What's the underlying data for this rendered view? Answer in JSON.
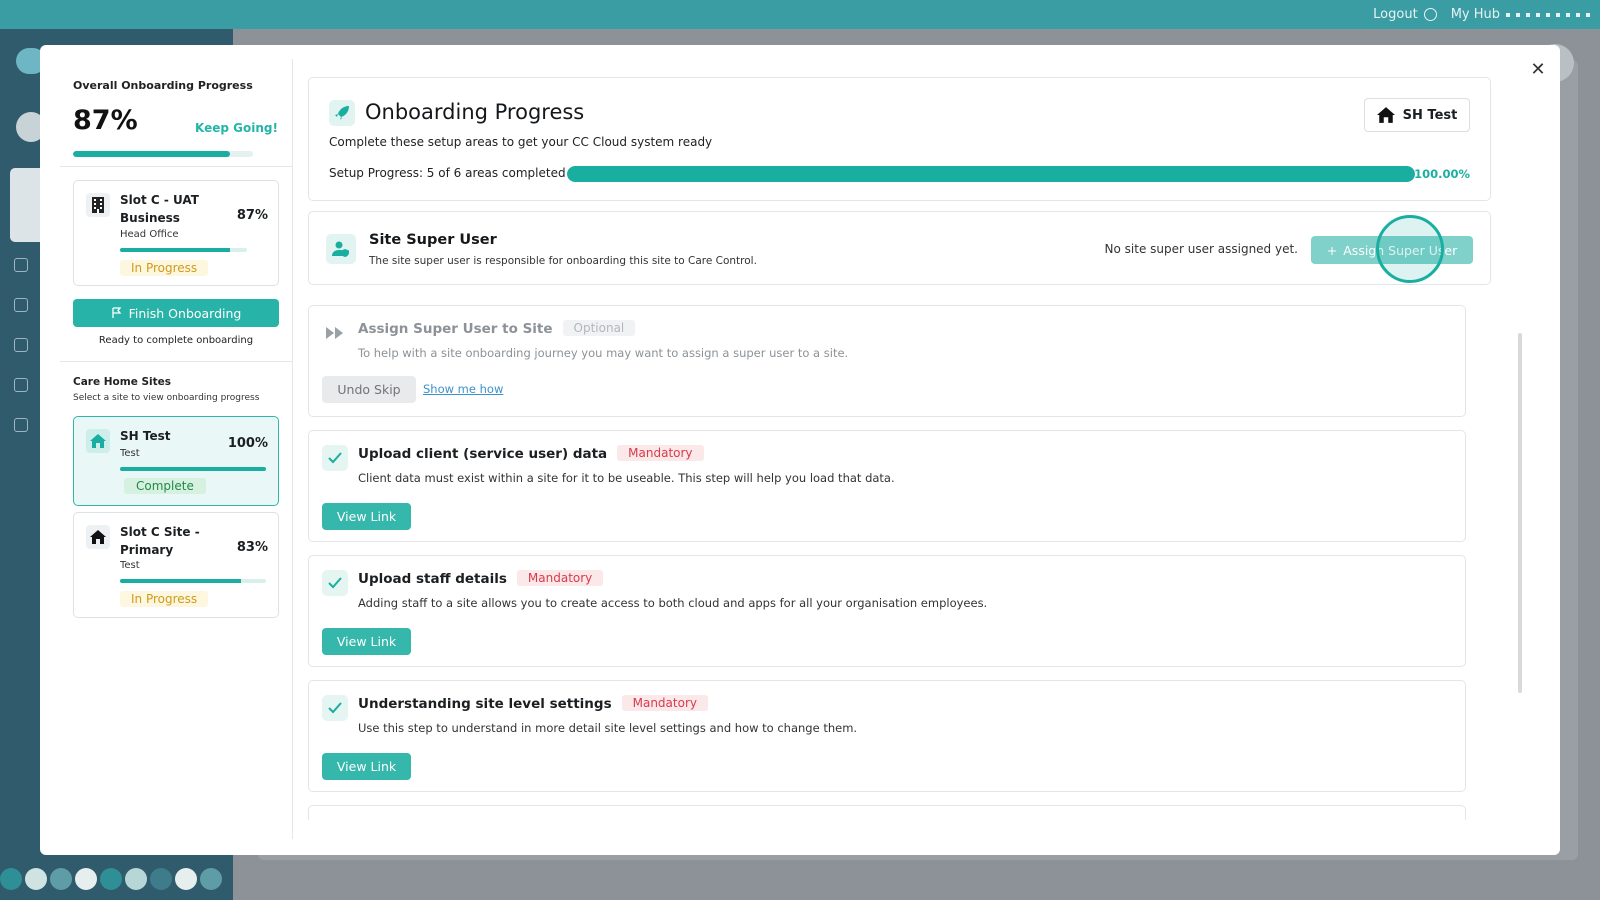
{
  "topbar": {
    "logout": "Logout",
    "hub": "My Hub"
  },
  "colors": {
    "accent": "#1aaea1",
    "mandatory": "#d83b4b",
    "progress": "#d19b1a",
    "complete": "#1f8a46"
  },
  "overall": {
    "title": "Overall Onboarding Progress",
    "percent": "87%",
    "percent_value": 87,
    "encouragement": "Keep Going!"
  },
  "current_site": {
    "name_lines": [
      "Slot C - UAT",
      "Business"
    ],
    "sub": "Head Office",
    "percent": "87%",
    "percent_value": 87,
    "status": "In Progress"
  },
  "finish": {
    "label": "Finish Onboarding",
    "ready": "Ready to complete onboarding"
  },
  "sites_section": {
    "title": "Care Home Sites",
    "subtitle": "Select a site to view onboarding progress",
    "sites": [
      {
        "name": "SH Test",
        "sub": "Test",
        "percent": "100%",
        "percent_value": 100,
        "status": "Complete",
        "icon": "home-icon"
      },
      {
        "name_lines": [
          "Slot C Site -",
          "Primary"
        ],
        "sub": "Test",
        "percent": "83%",
        "percent_value": 83,
        "status": "In Progress",
        "icon": "home-icon"
      }
    ]
  },
  "header": {
    "title": "Onboarding Progress",
    "subtitle": "Complete these setup areas to get your CC Cloud system ready",
    "site_button": "SH Test",
    "setup_label": "Setup Progress: 5 of 6 areas completed",
    "setup_percent": "100.00%",
    "setup_value": 100
  },
  "super_user": {
    "title": "Site Super User",
    "subtitle": "The site super user is responsible for onboarding this site to Care Control.",
    "none_text": "No site super user assigned yet.",
    "assign_label": "Assign Super User"
  },
  "steps": [
    {
      "title": "Assign Super User to Site",
      "badge": "Optional",
      "desc": "To help with a site onboarding journey you may want to assign a super user to a site.",
      "undo": "Undo Skip",
      "link": "Show me how"
    },
    {
      "title": "Upload client (service user) data",
      "badge": "Mandatory",
      "desc": "Client data must exist within a site for it to be useable. This step will help you load that data.",
      "button": "View Link"
    },
    {
      "title": "Upload staff details",
      "badge": "Mandatory",
      "desc": "Adding staff to a site allows you to create access to both cloud and apps for all your organisation employees.",
      "button": "View Link"
    },
    {
      "title": "Understanding site level settings",
      "badge": "Mandatory",
      "desc": "Use this step to understand in more detail site level settings and how to change them.",
      "button": "View Link"
    }
  ]
}
